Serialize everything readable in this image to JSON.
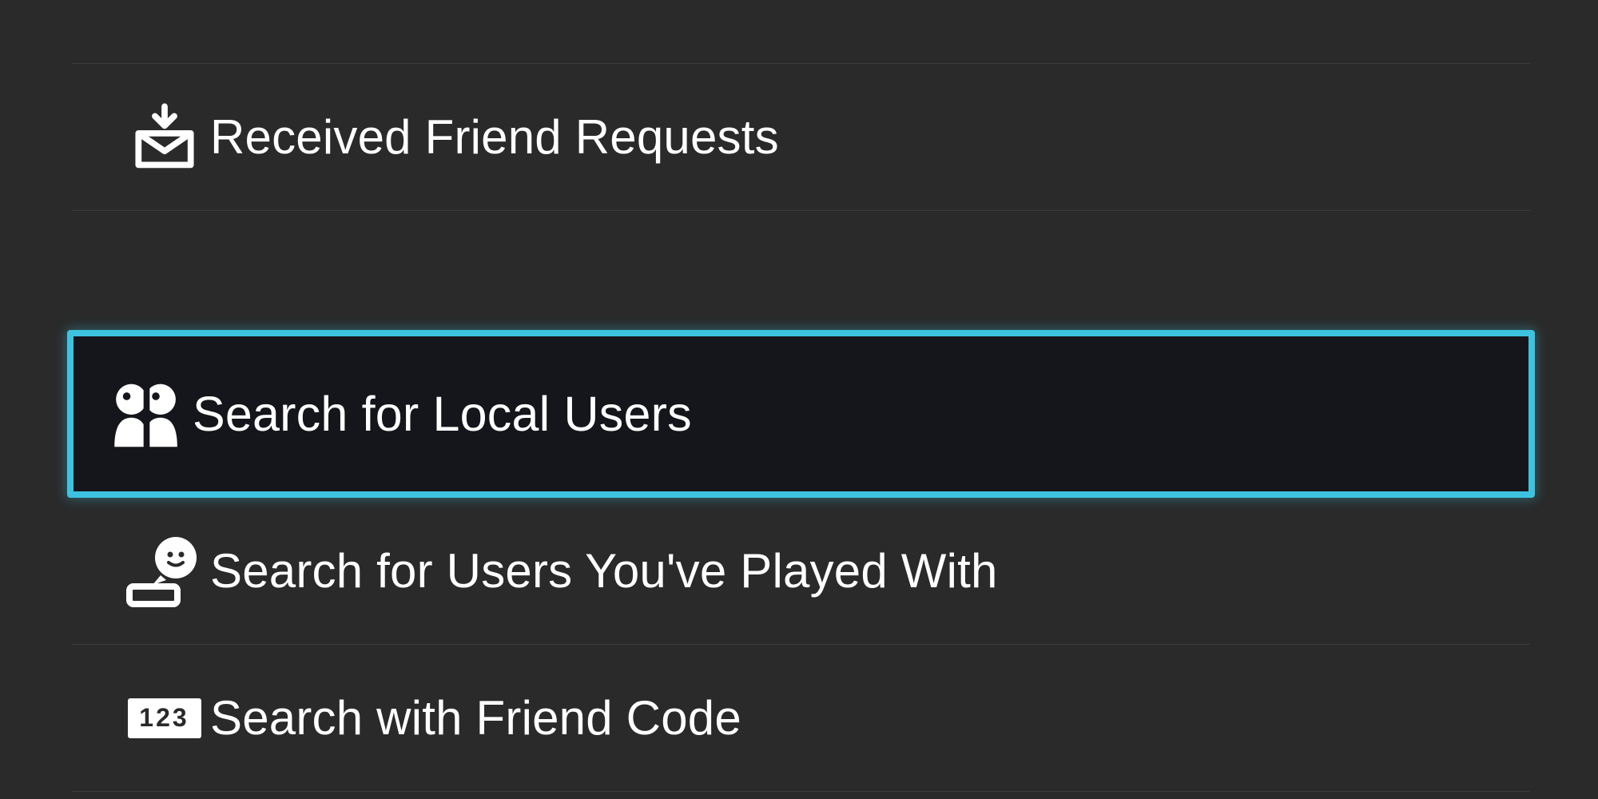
{
  "menu": {
    "received_requests": {
      "label": "Received Friend Requests"
    },
    "local_users": {
      "label": "Search for Local Users"
    },
    "played_with": {
      "label": "Search for Users You've Played With"
    },
    "friend_code": {
      "label": "Search with Friend Code",
      "badge": "123"
    }
  },
  "colors": {
    "highlight": "#3dc3e0",
    "bg": "#2a2a2a",
    "selected_bg": "#15161b"
  },
  "selected": "local_users"
}
